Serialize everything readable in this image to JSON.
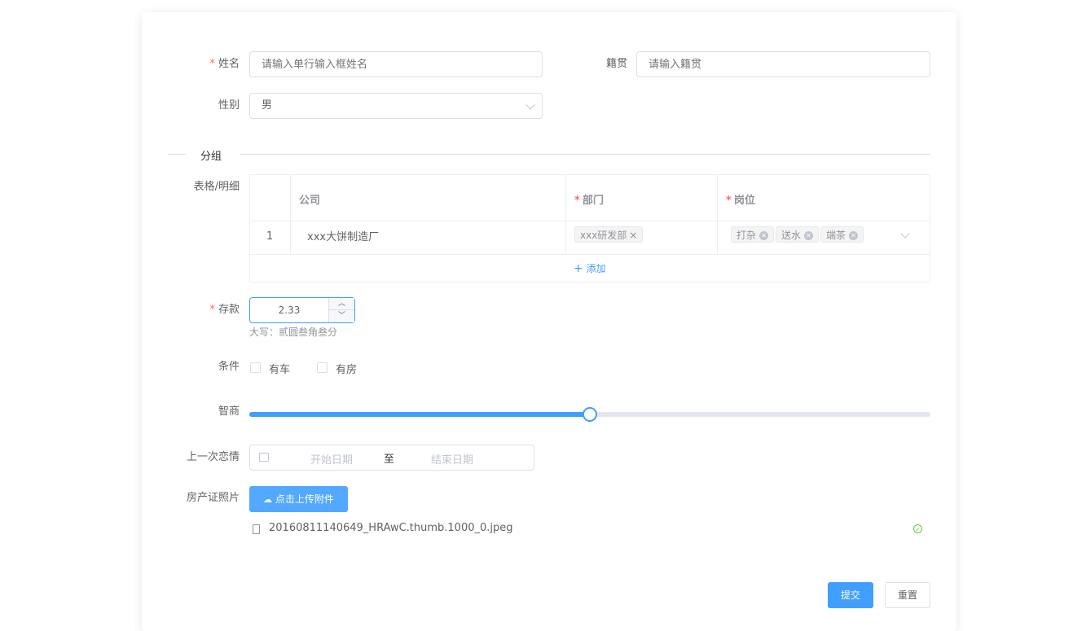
{
  "form": {
    "name": {
      "label": "姓名",
      "required_mark": "*",
      "placeholder": "请输入单行输入框姓名"
    },
    "hometown": {
      "label": "籍贯",
      "placeholder": "请输入籍贯"
    },
    "gender": {
      "label": "性别",
      "value": "男"
    },
    "group_divider": "分组",
    "table": {
      "label": "表格/明细",
      "columns": [
        {
          "title": "公司",
          "required": false
        },
        {
          "title": "部门",
          "required": true
        },
        {
          "title": "岗位",
          "required": true
        }
      ],
      "rows": [
        {
          "index": "1",
          "company": "xxx大饼制造厂",
          "department_tags": [
            "xxx研发部"
          ],
          "position_tags": [
            "打杂",
            "送水",
            "端茶"
          ]
        }
      ],
      "add_label": "添加",
      "add_icon": "plus-icon"
    },
    "deposit": {
      "label": "存款",
      "required_mark": "*",
      "value": "2.33",
      "hint": "大写：贰圆叁角叁分"
    },
    "conditions": {
      "label": "条件",
      "options": [
        "有车",
        "有房"
      ]
    },
    "iq": {
      "label": "智商",
      "value_fraction": 0.5
    },
    "last_love": {
      "label": "上一次恋情",
      "start_placeholder": "开始日期",
      "separator": "至",
      "end_placeholder": "结束日期"
    },
    "property_photo": {
      "label": "房产证照片",
      "upload_label": "点击上传附件",
      "files": [
        {
          "name": "20160811140649_HRAwC.thumb.1000_0.jpeg",
          "status": "success"
        }
      ]
    },
    "actions": {
      "submit": "提交",
      "reset": "重置"
    }
  },
  "colors": {
    "primary": "#409eff",
    "required": "#f56c6c",
    "success": "#67c23a",
    "border": "#dcdfe6"
  }
}
